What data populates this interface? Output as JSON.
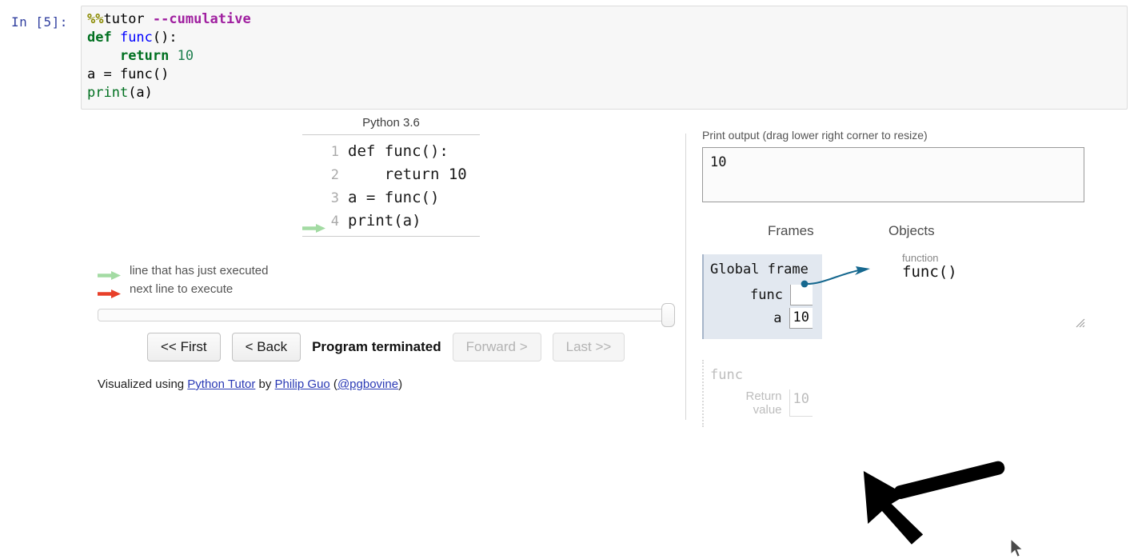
{
  "notebook": {
    "prompt": "In [5]:",
    "code_lines": [
      [
        {
          "t": "%%",
          "c": "tok-magic-pct"
        },
        {
          "t": "tutor ",
          "c": "tok-magic-name"
        },
        {
          "t": "--cumulative",
          "c": "tok-magic-arg"
        }
      ],
      [
        {
          "t": "def ",
          "c": "tok-kw"
        },
        {
          "t": "func",
          "c": "tok-fn"
        },
        {
          "t": "():",
          "c": "tok-plain"
        }
      ],
      [
        {
          "t": "    ",
          "c": "tok-plain"
        },
        {
          "t": "return ",
          "c": "tok-kw"
        },
        {
          "t": "10",
          "c": "tok-num"
        }
      ],
      [
        {
          "t": "a = func()",
          "c": "tok-plain"
        }
      ],
      [
        {
          "t": "print",
          "c": "tok-builtin"
        },
        {
          "t": "(a)",
          "c": "tok-plain"
        }
      ]
    ]
  },
  "tutor": {
    "python_version": "Python 3.6",
    "code_display": [
      {
        "num": "1",
        "code": "def func():",
        "arrow": "none"
      },
      {
        "num": "2",
        "code": "    return 10",
        "arrow": "none"
      },
      {
        "num": "3",
        "code": "a = func()",
        "arrow": "none"
      },
      {
        "num": "4",
        "code": "print(a)",
        "arrow": "green"
      }
    ],
    "legend": [
      {
        "arrow": "green",
        "label": "line that has just executed"
      },
      {
        "arrow": "red",
        "label": "next line to execute"
      }
    ],
    "controls": {
      "first_label": "<< First",
      "back_label": "< Back",
      "status": "Program terminated",
      "forward_label": "Forward >",
      "last_label": "Last >>"
    },
    "credits": {
      "prefix": "Visualized using ",
      "tool_link": "Python Tutor",
      "middle": " by ",
      "author_link": "Philip Guo",
      "open_paren": " (",
      "handle_link": "@pgbovine",
      "close_paren": ")"
    },
    "print_output": {
      "label": "Print output (drag lower right corner to resize)",
      "value": "10"
    },
    "columns": {
      "frames": "Frames",
      "objects": "Objects"
    },
    "global_frame": {
      "title": "Global frame",
      "vars": [
        {
          "name": "func",
          "value": "",
          "is_pointer": true
        },
        {
          "name": "a",
          "value": "10",
          "is_pointer": false
        }
      ]
    },
    "heap": {
      "func_object": {
        "type_label": "function",
        "name": "func()"
      }
    },
    "returned_frame": {
      "title": "func",
      "vars": [
        {
          "name": "Return\nvalue",
          "value": "10"
        }
      ]
    }
  },
  "colors": {
    "frame_bg": "#e2e8f0",
    "pointer_arrow": "#16688f",
    "green_arrow": "#a3dba3",
    "red_arrow": "#e8402a",
    "annotation_arrow": "#000000",
    "link": "#2a3ab5"
  }
}
